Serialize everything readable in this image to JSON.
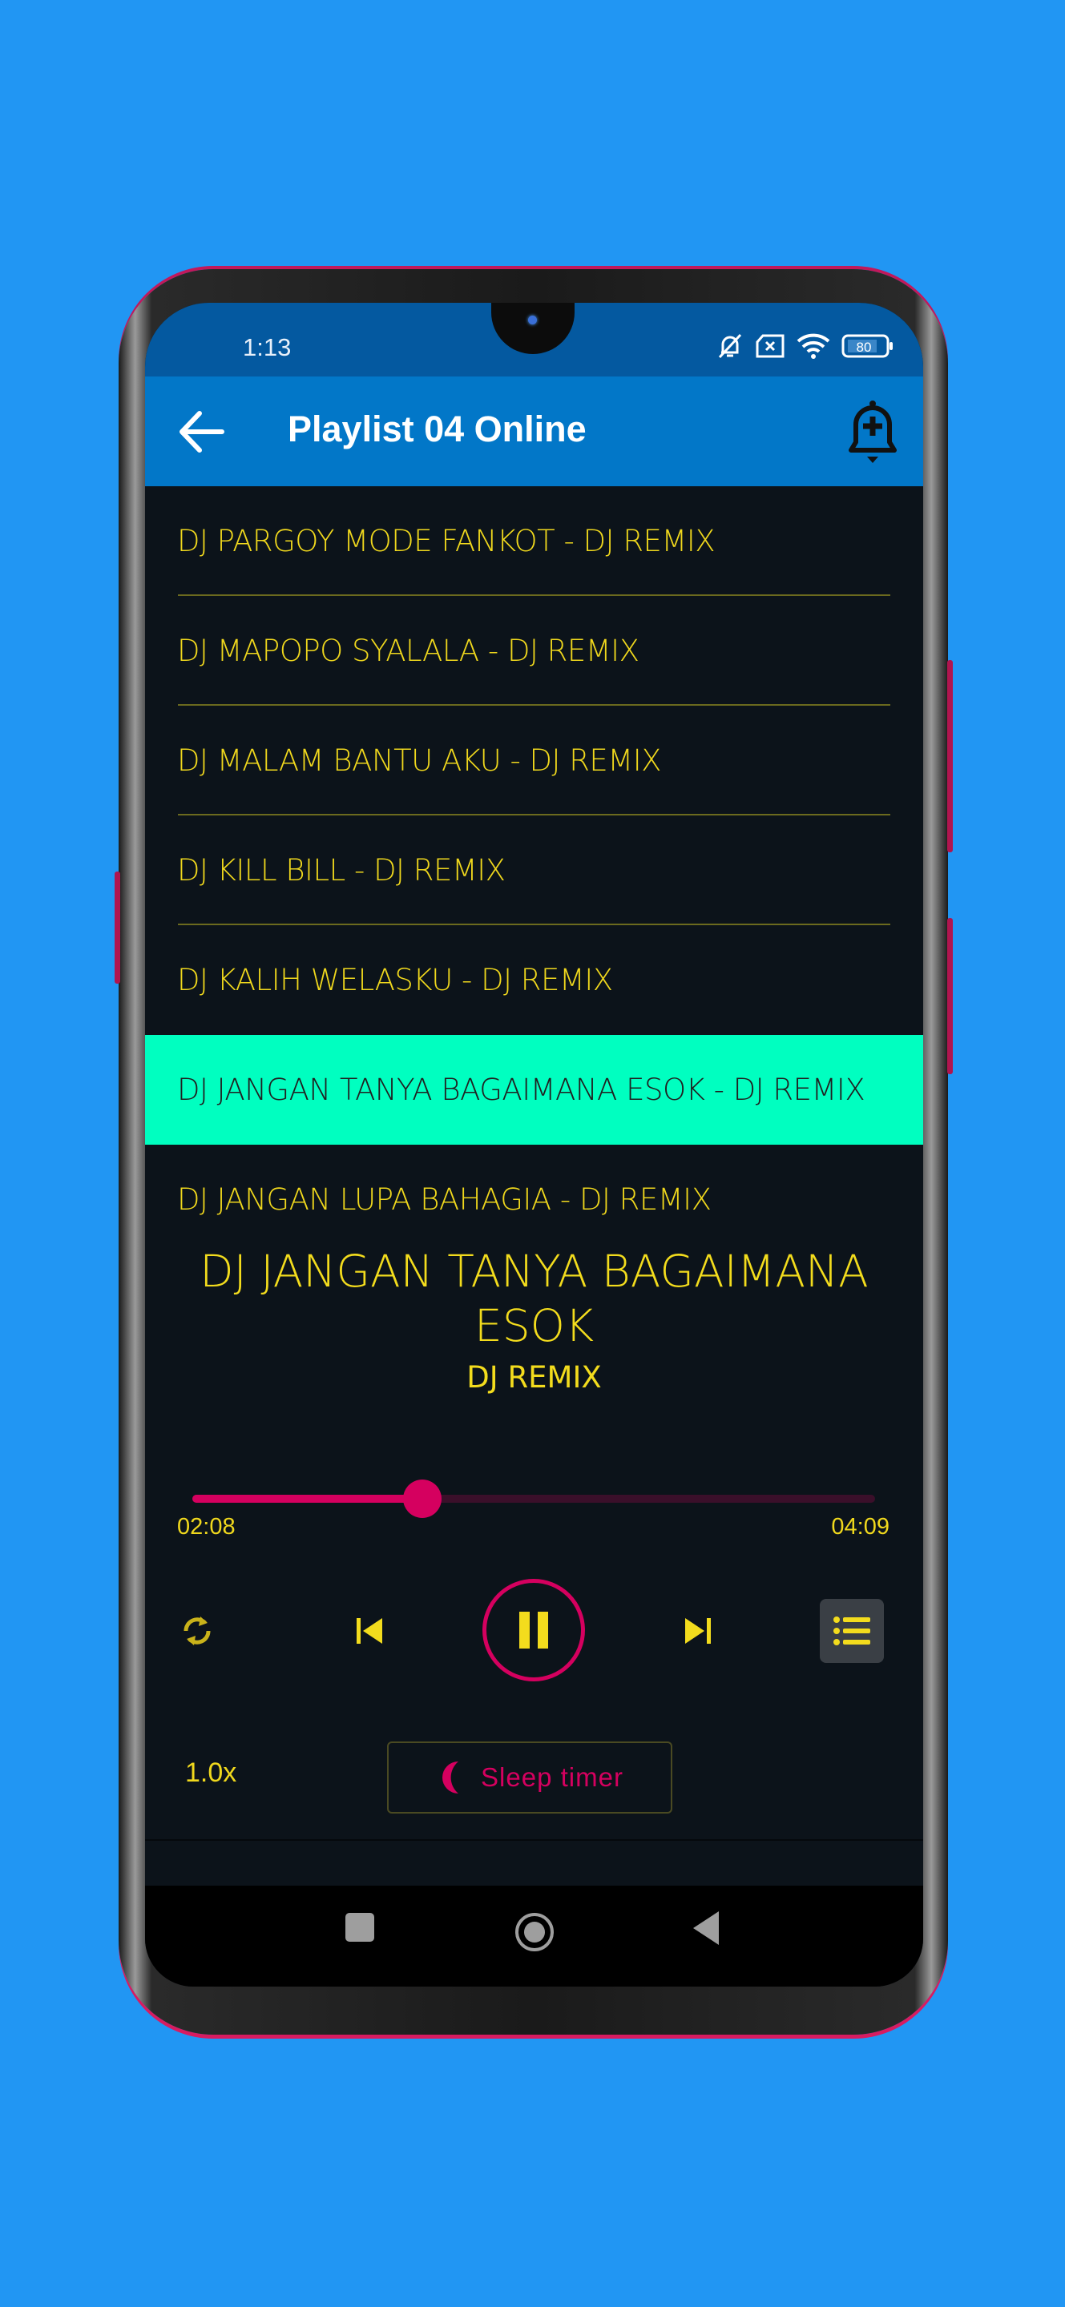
{
  "status_bar": {
    "time": "1:13",
    "battery_level": "80",
    "icons": [
      "bell-off-icon",
      "sim-x-icon",
      "wifi-icon",
      "battery-icon"
    ]
  },
  "app_bar": {
    "title": "Playlist 04 Online",
    "back_icon": "arrow-left-icon",
    "action_icon": "bell-plus-icon"
  },
  "playlist": {
    "items": [
      {
        "label": "DJ PARGOY MODE FANKOT - DJ REMIX",
        "active": false
      },
      {
        "label": "DJ MAPOPO SYALALA - DJ REMIX",
        "active": false
      },
      {
        "label": "DJ MALAM BANTU AKU - DJ REMIX",
        "active": false
      },
      {
        "label": "DJ KILL BILL - DJ REMIX",
        "active": false
      },
      {
        "label": "DJ KALIH WELASKU - DJ REMIX",
        "active": false
      },
      {
        "label": "DJ JANGAN TANYA BAGAIMANA ESOK - DJ REMIX",
        "active": true
      },
      {
        "label": "DJ JANGAN LUPA BAHAGIA - DJ REMIX",
        "active": false
      }
    ]
  },
  "now_playing": {
    "title": "DJ JANGAN TANYA BAGAIMANA ESOK",
    "artist": "DJ REMIX",
    "current_time": "02:08",
    "total_time": "04:09",
    "progress_fraction": 0.337
  },
  "controls": {
    "repeat_icon": "repeat-icon",
    "prev_icon": "skip-previous-icon",
    "play_pause_icon": "pause-icon",
    "next_icon": "skip-next-icon",
    "queue_icon": "queue-list-icon"
  },
  "footer": {
    "speed": "1.0x",
    "sleep_timer_label": "Sleep timer"
  },
  "colors": {
    "background": "#2196f3",
    "status_bar": "#0459a0",
    "app_bar": "#0277c8",
    "screen_bg": "#0c131a",
    "text_yellow": "#f0d81d",
    "accent_pink": "#d5005f",
    "active_row": "#00ffc0"
  },
  "nav_bar": {
    "buttons": [
      "recents-square-icon",
      "home-circle-icon",
      "back-triangle-icon"
    ]
  }
}
